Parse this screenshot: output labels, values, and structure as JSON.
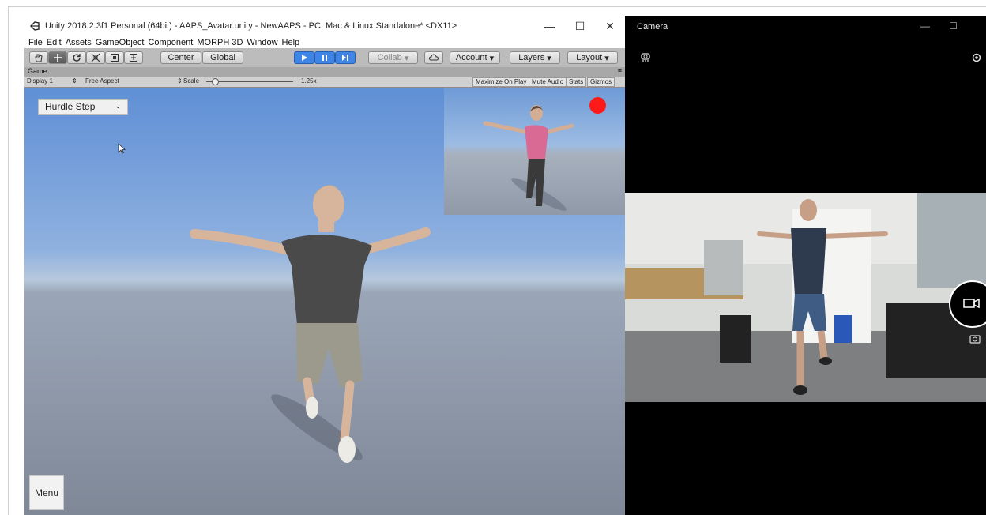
{
  "unity": {
    "title": "Unity 2018.2.3f1 Personal (64bit) - AAPS_Avatar.unity - NewAAPS - PC, Mac & Linux Standalone* <DX11>",
    "window_buttons": [
      "—",
      "☐",
      "✕"
    ],
    "menu": [
      "File",
      "Edit",
      "Assets",
      "GameObject",
      "Component",
      "MORPH 3D",
      "Window",
      "Help"
    ],
    "toolbar": {
      "center": "Center",
      "global": "Global",
      "collab": "Collab",
      "account": "Account",
      "layers": "Layers",
      "layout": "Layout"
    },
    "game_tab": "Game",
    "game_bar": {
      "display": "Display 1",
      "aspect": "Free Aspect",
      "scale_label": "Scale",
      "scale_value": "1.25x",
      "maximize": "Maximize On Play",
      "mute": "Mute Audio",
      "stats": "Stats",
      "gizmos": "Gizmos"
    },
    "scale": 0.1,
    "viewport": {
      "dropdown_value": "Hurdle Step",
      "menu_button": "Menu",
      "recording_color": "#ff1a1a"
    }
  },
  "camera": {
    "title": "Camera",
    "window_buttons": [
      "—",
      "☐"
    ]
  }
}
